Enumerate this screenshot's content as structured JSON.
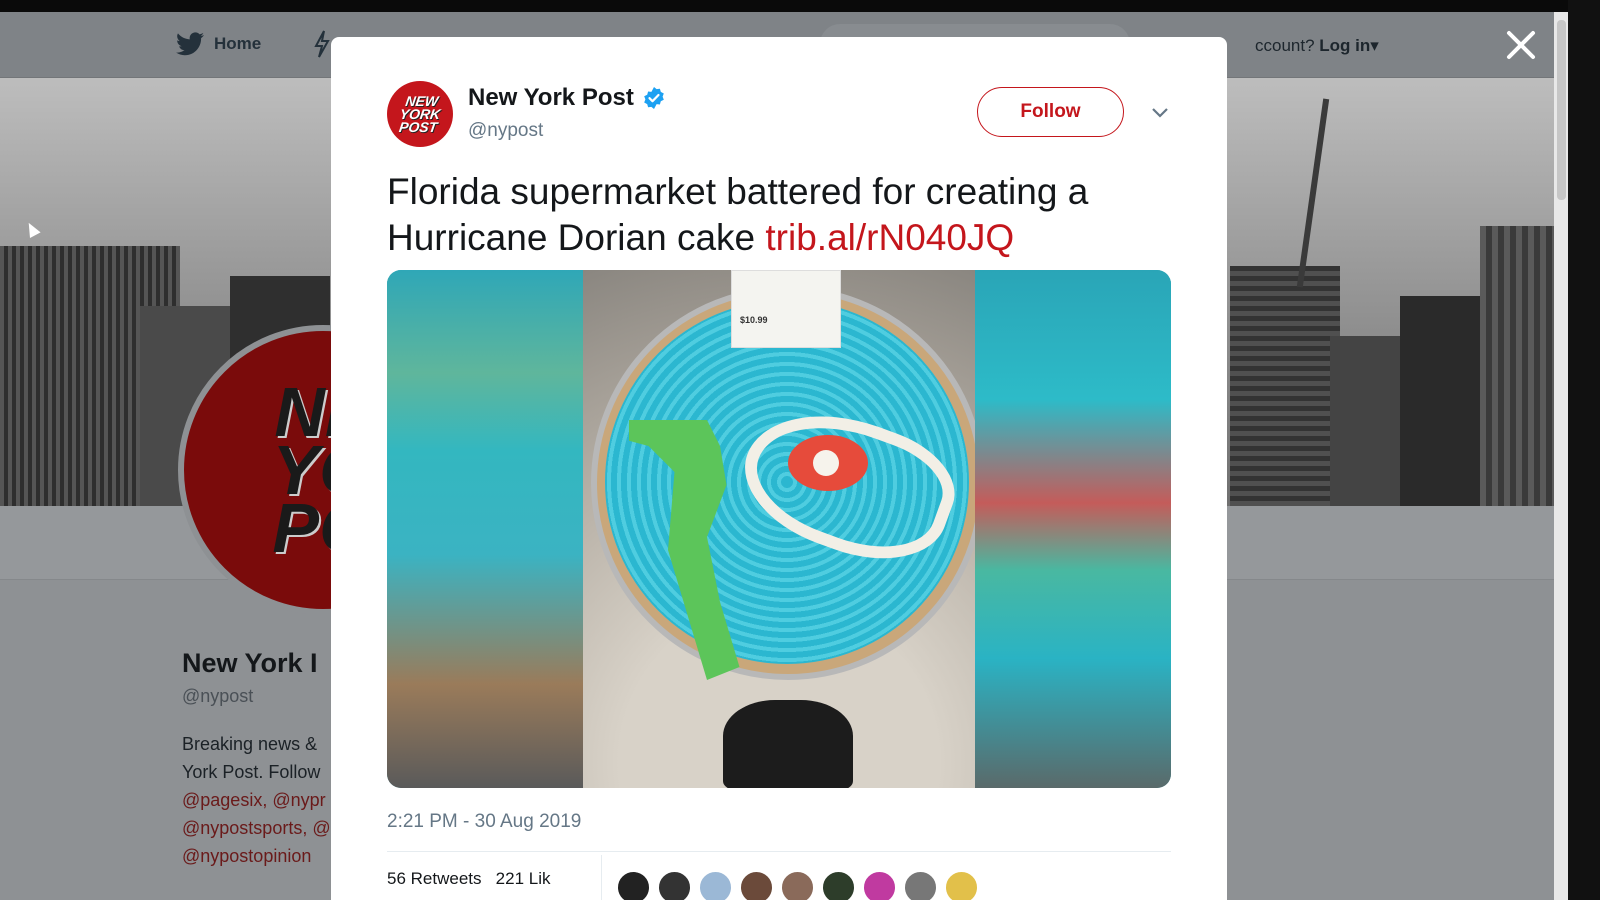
{
  "nav": {
    "home_label": "Home",
    "login_prefix": "ccount?",
    "login_label": "Log in",
    "login_arrow": "▾"
  },
  "profile": {
    "avatar_text_lines": [
      "NE",
      "YO",
      "PO"
    ],
    "name": "New York I",
    "handle": "@nypost",
    "bio_lines": [
      "Breaking news &",
      "York Post. Follow"
    ],
    "bio_links": [
      "@pagesix, @nypr",
      "@nypostsports, @",
      "@nypostopinion"
    ]
  },
  "tweet": {
    "author_name": "New York Post",
    "author_handle": "@nypost",
    "avatar_text": "NEW YORK POST",
    "follow_label": "Follow",
    "text": "Florida supermarket battered for creating a Hurricane Dorian cake ",
    "link": "trib.al/rN040JQ",
    "timestamp": "2:21 PM - 30 Aug 2019",
    "retweets_partial": "56 Retweets",
    "likes_partial": "221 Lik",
    "price_tag": "$10.99",
    "verified": true
  },
  "colors": {
    "brand_red": "#c4161c",
    "twitter_blue": "#1da1f2",
    "text_dark": "#14171a",
    "text_muted": "#657786"
  },
  "icons": {
    "close": "close-icon",
    "bird": "twitter-bird-icon",
    "bolt": "moments-bolt-icon",
    "verified": "verified-badge-icon",
    "chevron": "chevron-down-icon"
  }
}
